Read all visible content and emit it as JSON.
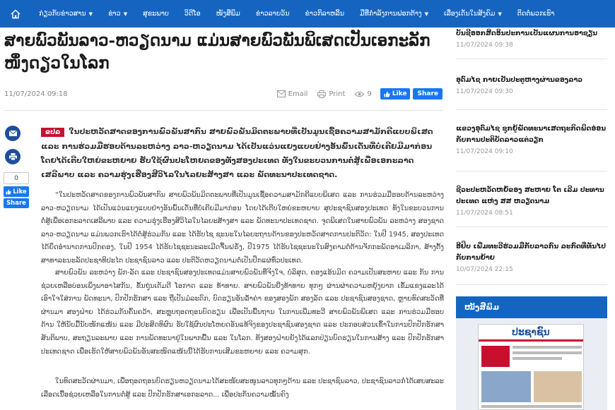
{
  "nav": {
    "items": [
      {
        "label": "ກ່ຽວກັບຂ່າວສານ",
        "dropdown": true
      },
      {
        "label": "ຂ່າວ",
        "dropdown": true
      },
      {
        "label": "ສຸຂະພາບ",
        "dropdown": false
      },
      {
        "label": "ວິດີໂອ",
        "dropdown": false
      },
      {
        "label": "ໜັງສືພິມ",
        "dropdown": false
      },
      {
        "label": "ຂ່າວລາຍວັນ",
        "dropdown": false
      },
      {
        "label": "ຂ່າວກິລາຫລິ້ນ",
        "dropdown": false
      },
      {
        "label": "ມືທີ່ກໍາລັງການຟອກຕ້າງ",
        "dropdown": true
      },
      {
        "label": "ເລື່ອງເດັ່ນໃນສັງຄົມ",
        "dropdown": true
      },
      {
        "label": "ຕິດຕໍ່ພວກເຮົາ",
        "dropdown": false
      }
    ],
    "chevron": "▼"
  },
  "article": {
    "title": "ສາຍພົວພັນລາວ-ຫວຽດນາມ ແມ່ນສາຍພົວພັນພິເສດເປັນເອກະລັກໜຶ່ງດຽວໃນໂລກ",
    "date": "11/07/2024 09:18",
    "email_label": "Email",
    "print_label": "Print",
    "views": "9",
    "like_label": "Like",
    "share_label": "Share",
    "lead_tag": "ຂປລ",
    "lead": "ໃນປະຫວັດສາດຂອງການພົວພັນສາກົນ ສາຍພົວພັນມິດຕະພາບທີ່ເປັນມູນເຊື້ອຄວາມສາມັກຄີແບບພິເສດ ແລະ ການຮ່ວມມືຮອບດ້ານລະຫວ່າງ ລາວ-ຫວຽດນາມ ໄດ້ເປັນແວ່ນແຍງແບບຢ່າງອັນພົ້ນເດັ່ນທີ່ບໍ່ເຄີຍມີມາກ່ອນ ໂດຍໄດ້ເຕີບໃຫຍ່ຂະຫຍາຍ ຮັບໃຊ້ຜົນປະໂຫຍດຂອງທັງສອງປະເທດ ທັງໃນຂະບວນການຕໍ່ສູ້ເພື່ອເອກະລາດເສລີພາບ ແລະ ຄວາມຮຸ່ງເຮືອງສີວິໄລໃນໄລຍະສ້າງສາ ແລະ ພັດທະນາປະເທດຊາດ.",
    "paragraphs": [
      "“ໃນປະຫວັດສາດຂອງການພົວພັນສາກົນ ສາຍພົວພັນມິດຕະພາບທີ່ເປັນມູນເຊື້ອຄວາມສາມັກຄີແບບພິເສດ ແລະ ການຮ່ວມມືຮອບດ້ານລະຫວ່າງ ລາວ-ຫວຽດນາມ ໄດ້ເປັນແວ່ນແຍງແບບຢ່າງອັນພົ້ນເດັ່ນທີ່ບໍ່ເຄີຍມີມາກ່ອນ ໂດຍໄດ້ເຕີບໃຫຍ່ຂະຫຍາຍ ສຸປະຊາຊົນສອງປະເທດ ທັງໃນຂະບວນການຕໍ່ສູ້ເພື່ອເອກະລາດເສລີພາບ ແລະ ຄວາມຮຸ່ງເຮືອງສີວິໄລໃນໄລຍະສ້າງສາ ແລະ ພັດທະນາປະເທດຊາດ. ຈຸດພິເສດໃນສາຍພົວພັນ ລະຫວ່າງ ສອງຊາດລາວ-ຫວຽດນາມ ແມ່ນພວກເຮົາໄດ້ຕໍ່ສູ້ຮ່ວມກັນ ແລະ ໄດ້ຮັບໄຊ ຊະນະໃນໄລຍະຖານດ້ານຂອງປະຫວັດສາດການປະຕິວັດ: ໃນປີ 1945, ສອງປະເທດໄດ້ຍຶດອຳນາດການປົກຄອງ, ໃນປີ 1954 ໄດ້ຮັບໄຊຊະນະລະເມີດຈື້ນຝຣັ່ງ, ປີ1975 ໄດ້ຮັບໄຊຊະນະໃນສົງຄາມຕໍ່ຕ້ານຈັກກະພັດອາເມລິກາ, ສ້າງຕັ້ງສາທາລະນະລັດປະຊາທິປະໄຕ ປະຊາຊົນລາວ ແລະ ປະຕິວັດຫວຽດນາມຕໍ່ເປັນປຶກແຜ່ທົ່ວປະເທດ.",
      "ສາຍພົວພັນ ລະຫວ່າງ ພັກ-ລັດ ແລະ ປະຊາຊົນສອງປະເທດແມ່ນສາຍພົວພັນທີ່ຈິງໃຈ, ບໍລິສຸດ, ຄອງແອ້ນມິດ ຄວາມເປັນສະຫາຍ ແລະ ກັນ ການຊ່ວຍເຫລືອບ່ອນເພິ່ງພາອາໄສກັນ, ຂັ້ນຖຸ່ນເຕັມດີ ໂອກາດ ແລະ ທ້າທາຍ. ສາຍພົວພັນຍີ່ງທ້າທາຍ ທຸກໆ ຜ່ານຜ່າຄວາມຫຍຸ້ງຍາກ ເຂັ້ມແຂງແລະໄດ້ ເອົາໃຈໃສ່ການ ພັດທະນາ, ປົກປັກຮັກສາ ແລະ ຖືເປັນມໍລະດົກ, ບົດຮຽນອັນລ້ຳຄ່າ ຂອງສອງພັກ ສອງລັດ ແລະ ປະຊາຊົນສອງຊາດ, ຫຼາຍທົດສະວັດທີ່ຜ່ານມາ ສອງຝ່າຍ ໄດ້ຮ່ວມກັນຄົ້ນຄວ້າ, ສະຫຼຸບຖອດຖອນບົດຮຽນ ເພື່ອເປັນພື້ນຖານ ໃນການເພີ່ມທະວີ ສາຍພົວພັນພິເສດ ແລະ ການຮ່ວມມືຮອບດ້ານ ໃຫ້ນັບມື້ນັບໜັກແໜ້ນ ແລະ ມີປະສິດທິຜົນ ຮັບໃຊ້ຜົນປະໂຫຍດອັນແທ້ຈິງຂອງປະຊາຊົນສອງຊາດ ແລະ ປະກອບສ່ວນເຂົ້າໃນການປົກປັກຮັກສາສັນຕິພາບ, ສະຖຽນລະພາບ ແລະ ການພັດທະນາຢູ່ໃນພາກພື້ນ ແລະ ໃນໂລກ. ທັງສອງຝ່າຍຍັງໄດ້ແລກປ່ຽນບົດຮຽນໃນການສ້າງ ແລະ ປົກປັກຮັກສາປະເທດຊາດ ເພື່ອເຮັດໃຫ້ສາຍພົວພັນອັນສະໜິດແໜ້ນນີ້ໄດ້ຮັບການເສີມຂະຫຍາຍ ແລະ ຄວາມສຸກ.",
      "ໃນທົດສະວັດຜ່ານມາ, ເພື່ອຖອດຖອນບົດຮຽນຫວຽດນາມໄດ້ສະໜັບສະໜູນລາວທຸກໆດ້ານ ແລະ ປະຊາຊົນລາວ, ປະຊາຊົນລາວກໍ່ໄດ້ເສຍສະລະເລືອດເນື້ອຊ່ວຍເຫລືອໃນການຕໍ່ສູ້ ແລະ ປົກປັກຮັກສາເອກະລາດ... ເພື່ອປະກັນຄວາມໝັ້ນຄົງ"
    ]
  },
  "sidebar": {
    "items": [
      {
        "title": "ບັນຊີອອກສິດອິນປະການເປັນແຜນການອາຊຽນ",
        "date": "11/07/2024 09:38"
      },
      {
        "title": "ອຸດົມໄຊ ກາຍເປັນປະຕູຫາງຜ່ານຂອງລາວ",
        "date": "11/07/2024 09:30"
      },
      {
        "title": "ແຂວງອຸດົມໄຊ ຊຸກຍູ້ພັດທະນາເສດຖະກິດພິດອ່ອນກັບການປະຕິບັດລາວແຕ່ວຽກ",
        "date": "11/07/2024 09:10"
      },
      {
        "title": "ຊີວະປະຫວັດຫຍໍ້ຂອງ ສະຫາຍ ໂຕ ເລີມ ປະທານປະເທດ ແຫ່ງ ສສ ຫວຽດນາມ",
        "date": "11/07/2024 08:51"
      },
      {
        "title": "ອີຢິບ ເພີ່ມທະວີຮ່ວມມືກັບລາວກົນ ລະກົດທີ່ທັນໄປກັບການຍ້າຍ",
        "date": "10/07/2024 22:15"
      }
    ],
    "newspaper_header": "ໜັງສືພິມ",
    "paper_name": "ປະຊາຊົນ"
  },
  "rail": {
    "count": "0",
    "like_label": "Like",
    "share_label": "Share"
  }
}
